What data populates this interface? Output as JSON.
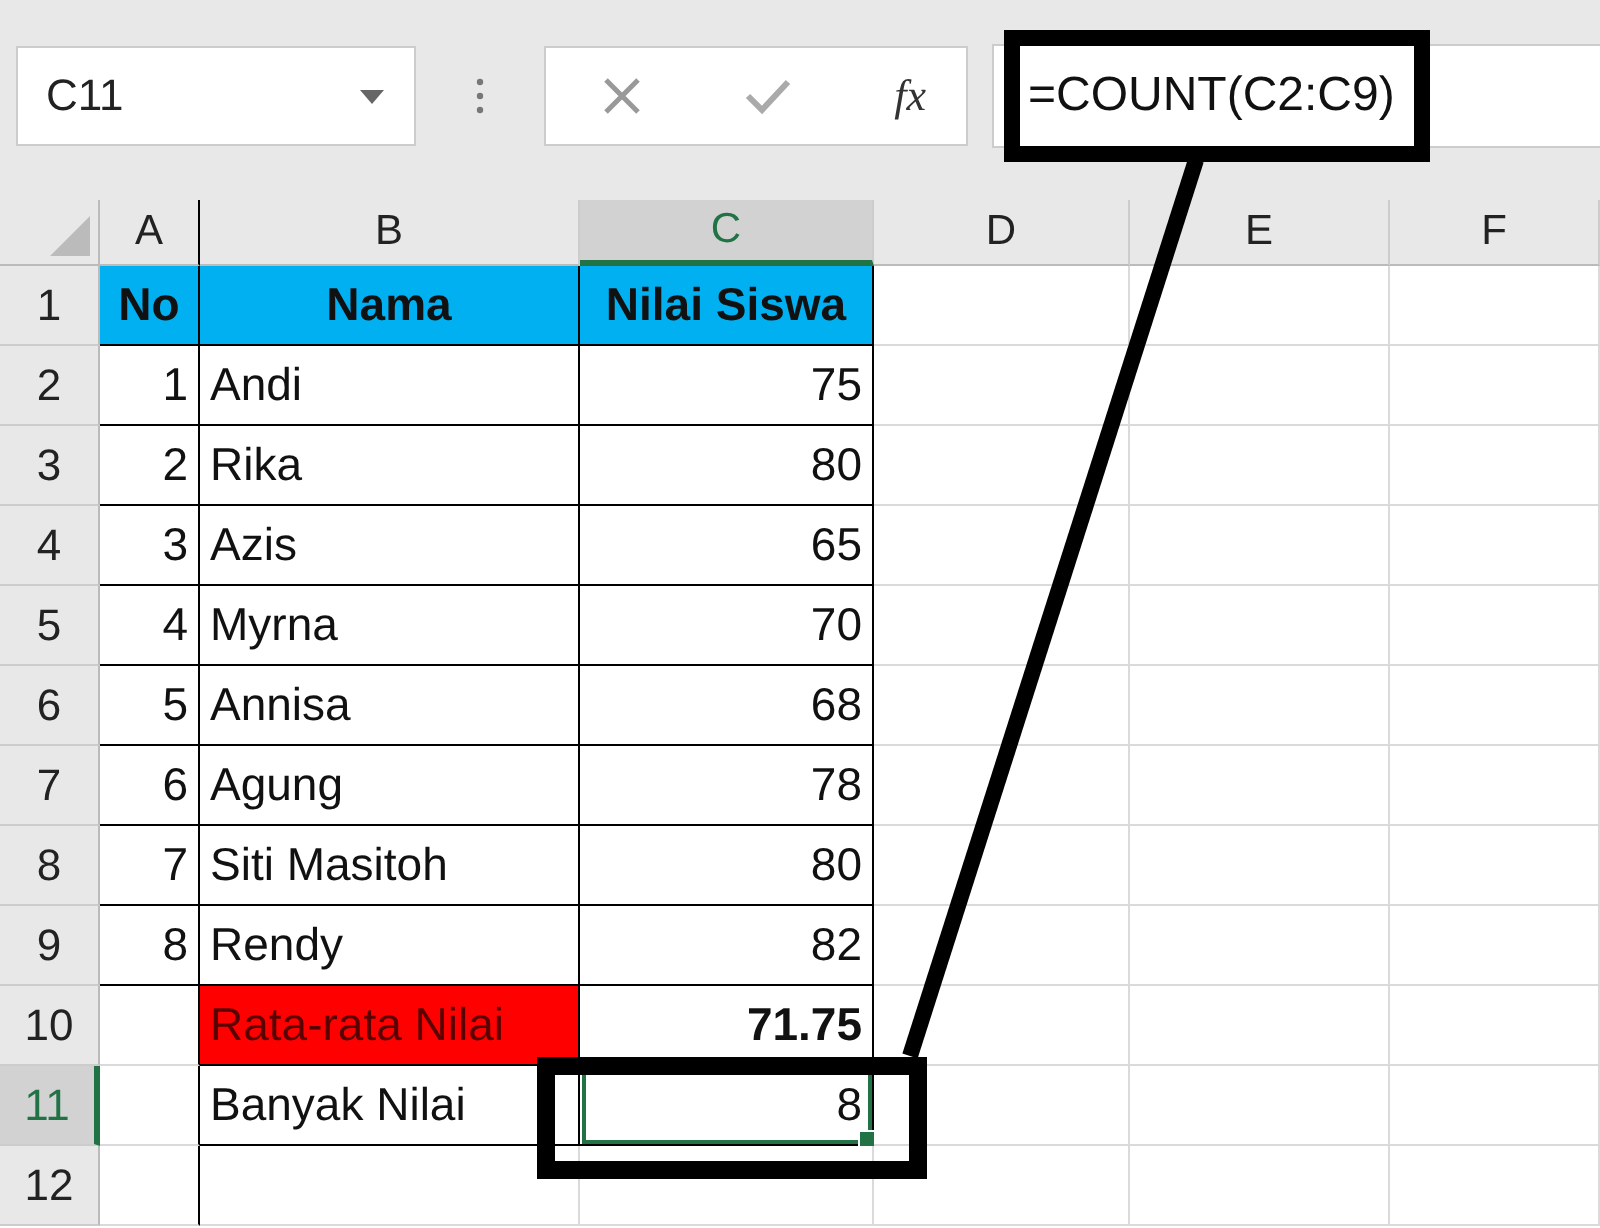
{
  "name_box": {
    "value": "C11"
  },
  "formula_bar": {
    "fx_label": "fx",
    "value": "=COUNT(C2:C9)"
  },
  "columns": [
    {
      "label": "A",
      "selected": false
    },
    {
      "label": "B",
      "selected": false
    },
    {
      "label": "C",
      "selected": true
    },
    {
      "label": "D",
      "selected": false
    },
    {
      "label": "E",
      "selected": false
    },
    {
      "label": "F",
      "selected": false
    }
  ],
  "rows": [
    {
      "number": "1",
      "selected": false,
      "cells": [
        {
          "kind": "header",
          "text": "No",
          "selected": false
        },
        {
          "kind": "header",
          "text": "Nama",
          "selected": false
        },
        {
          "kind": "header",
          "text": "Nilai Siswa",
          "selected": false
        },
        {
          "kind": "empty",
          "selected": false
        },
        {
          "kind": "empty",
          "selected": false
        },
        {
          "kind": "empty",
          "selected": false
        }
      ]
    },
    {
      "number": "2",
      "selected": false,
      "cells": [
        {
          "kind": "number",
          "text": "1",
          "selected": false
        },
        {
          "kind": "text",
          "text": "Andi",
          "selected": false
        },
        {
          "kind": "number",
          "text": "75",
          "selected": false
        },
        {
          "kind": "empty",
          "selected": false
        },
        {
          "kind": "empty",
          "selected": false
        },
        {
          "kind": "empty",
          "selected": false
        }
      ]
    },
    {
      "number": "3",
      "selected": false,
      "cells": [
        {
          "kind": "number",
          "text": "2",
          "selected": false
        },
        {
          "kind": "text",
          "text": "Rika",
          "selected": false
        },
        {
          "kind": "number",
          "text": "80",
          "selected": false
        },
        {
          "kind": "empty",
          "selected": false
        },
        {
          "kind": "empty",
          "selected": false
        },
        {
          "kind": "empty",
          "selected": false
        }
      ]
    },
    {
      "number": "4",
      "selected": false,
      "cells": [
        {
          "kind": "number",
          "text": "3",
          "selected": false
        },
        {
          "kind": "text",
          "text": "Azis",
          "selected": false
        },
        {
          "kind": "number",
          "text": "65",
          "selected": false
        },
        {
          "kind": "empty",
          "selected": false
        },
        {
          "kind": "empty",
          "selected": false
        },
        {
          "kind": "empty",
          "selected": false
        }
      ]
    },
    {
      "number": "5",
      "selected": false,
      "cells": [
        {
          "kind": "number",
          "text": "4",
          "selected": false
        },
        {
          "kind": "text",
          "text": "Myrna",
          "selected": false
        },
        {
          "kind": "number",
          "text": "70",
          "selected": false
        },
        {
          "kind": "empty",
          "selected": false
        },
        {
          "kind": "empty",
          "selected": false
        },
        {
          "kind": "empty",
          "selected": false
        }
      ]
    },
    {
      "number": "6",
      "selected": false,
      "cells": [
        {
          "kind": "number",
          "text": "5",
          "selected": false
        },
        {
          "kind": "text",
          "text": "Annisa",
          "selected": false
        },
        {
          "kind": "number",
          "text": "68",
          "selected": false
        },
        {
          "kind": "empty",
          "selected": false
        },
        {
          "kind": "empty",
          "selected": false
        },
        {
          "kind": "empty",
          "selected": false
        }
      ]
    },
    {
      "number": "7",
      "selected": false,
      "cells": [
        {
          "kind": "number",
          "text": "6",
          "selected": false
        },
        {
          "kind": "text",
          "text": "Agung",
          "selected": false
        },
        {
          "kind": "number",
          "text": "78",
          "selected": false
        },
        {
          "kind": "empty",
          "selected": false
        },
        {
          "kind": "empty",
          "selected": false
        },
        {
          "kind": "empty",
          "selected": false
        }
      ]
    },
    {
      "number": "8",
      "selected": false,
      "cells": [
        {
          "kind": "number",
          "text": "7",
          "selected": false
        },
        {
          "kind": "text",
          "text": "Siti Masitoh",
          "selected": false
        },
        {
          "kind": "number",
          "text": "80",
          "selected": false
        },
        {
          "kind": "empty",
          "selected": false
        },
        {
          "kind": "empty",
          "selected": false
        },
        {
          "kind": "empty",
          "selected": false
        }
      ]
    },
    {
      "number": "9",
      "selected": false,
      "cells": [
        {
          "kind": "number",
          "text": "8",
          "selected": false
        },
        {
          "kind": "text",
          "text": "Rendy",
          "selected": false
        },
        {
          "kind": "number",
          "text": "82",
          "selected": false
        },
        {
          "kind": "empty",
          "selected": false
        },
        {
          "kind": "empty",
          "selected": false
        },
        {
          "kind": "empty",
          "selected": false
        }
      ]
    },
    {
      "number": "10",
      "selected": false,
      "cells": [
        {
          "kind": "empty",
          "selected": false
        },
        {
          "kind": "highlight",
          "text": "Rata-rata Nilai",
          "selected": false
        },
        {
          "kind": "total",
          "text": "71.75",
          "selected": false
        },
        {
          "kind": "empty",
          "selected": false
        },
        {
          "kind": "empty",
          "selected": false
        },
        {
          "kind": "empty",
          "selected": false
        }
      ]
    },
    {
      "number": "11",
      "selected": true,
      "cells": [
        {
          "kind": "empty",
          "selected": false
        },
        {
          "kind": "text",
          "text": "Banyak Nilai",
          "selected": false
        },
        {
          "kind": "number",
          "text": "8",
          "selected": true
        },
        {
          "kind": "empty",
          "selected": false
        },
        {
          "kind": "empty",
          "selected": false
        },
        {
          "kind": "empty",
          "selected": false
        }
      ]
    },
    {
      "number": "12",
      "selected": false,
      "cells": [
        {
          "kind": "empty",
          "selected": false
        },
        {
          "kind": "empty",
          "selected": false
        },
        {
          "kind": "empty",
          "selected": false
        },
        {
          "kind": "empty",
          "selected": false
        },
        {
          "kind": "empty",
          "selected": false
        },
        {
          "kind": "empty",
          "selected": false
        }
      ]
    }
  ]
}
